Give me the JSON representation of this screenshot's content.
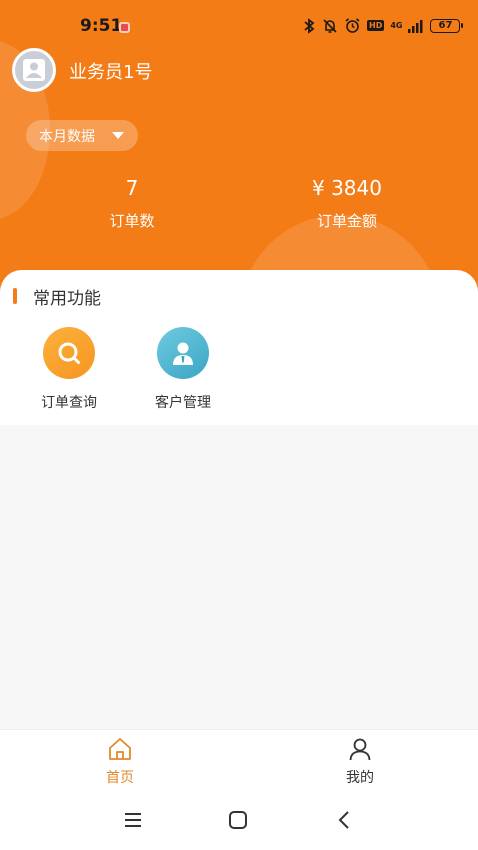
{
  "status_bar": {
    "time": "9:51",
    "network": "4G",
    "hd_badge": "HD",
    "battery": "67"
  },
  "user": {
    "name": "业务员1号"
  },
  "range_selector": {
    "label": "本月数据"
  },
  "stats": {
    "orders": {
      "value": "7",
      "label": "订单数"
    },
    "amount": {
      "value": "¥ 3840",
      "label": "订单金额"
    }
  },
  "section": {
    "title": "常用功能",
    "items": [
      {
        "label": "订单查询",
        "icon": "search-icon"
      },
      {
        "label": "客户管理",
        "icon": "customer-icon"
      }
    ]
  },
  "tabbar": {
    "home_label": "首页",
    "mine_label": "我的"
  },
  "colors": {
    "brand": "#f47c17",
    "tab_active": "#e08a2c"
  }
}
